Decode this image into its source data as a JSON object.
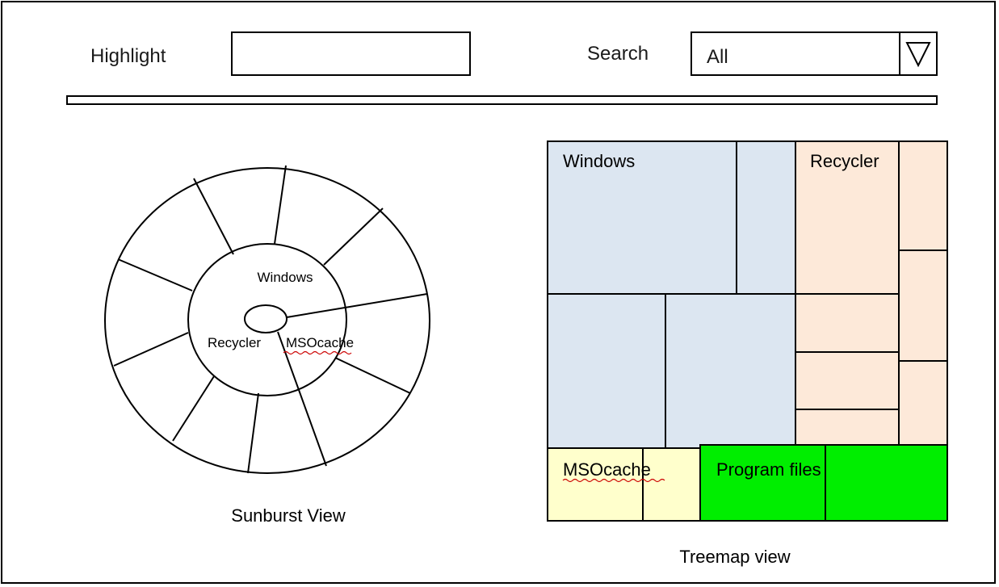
{
  "toolbar": {
    "highlight_label": "Highlight",
    "highlight_value": "",
    "search_label": "Search",
    "search_selected": "All"
  },
  "sunburst": {
    "caption": "Sunburst View",
    "inner_labels": [
      "Windows",
      "Recycler",
      "MSOcache"
    ]
  },
  "treemap": {
    "caption": "Treemap view",
    "regions": [
      {
        "label": "Windows",
        "color": "#dce6f1"
      },
      {
        "label": "Recycler",
        "color": "#fde9d9"
      },
      {
        "label": "MSOcache",
        "color": "#ffffcc"
      },
      {
        "label": "Program files",
        "color": "#00ee00"
      }
    ]
  },
  "colors": {
    "windows": "#dce6f1",
    "recycler": "#fde9d9",
    "msocache": "#ffffcc",
    "program_files": "#00ee00",
    "spellcheck_underline": "#cc0000"
  }
}
